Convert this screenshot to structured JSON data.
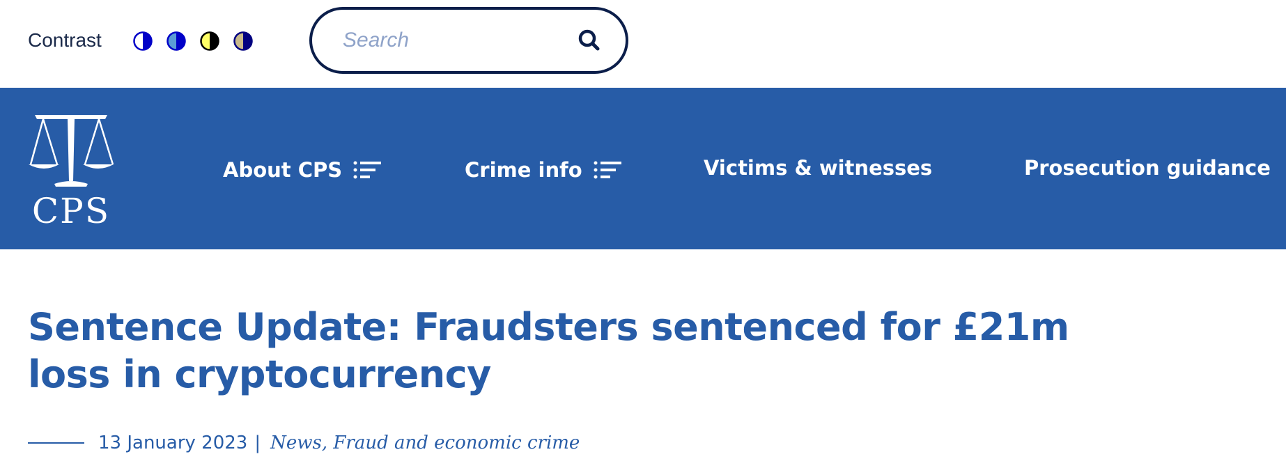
{
  "utility_bar": {
    "contrast_label": "Contrast",
    "contrast_options": [
      {
        "icon": "contrast-default-icon",
        "left_color": "#ffffff",
        "right_color": "#0000c8"
      },
      {
        "icon": "contrast-blue-icon",
        "left_color": "#5b9bd5",
        "right_color": "#0000c8"
      },
      {
        "icon": "contrast-yellow-icon",
        "left_color": "#ffff66",
        "right_color": "#000000"
      },
      {
        "icon": "contrast-beige-icon",
        "left_color": "#c8b98a",
        "right_color": "#000080"
      }
    ],
    "search": {
      "placeholder": "Search",
      "value": "",
      "icon": "search-icon"
    }
  },
  "nav": {
    "logo_text": "CPS",
    "items": [
      {
        "label": "About CPS",
        "has_menu_icon": true
      },
      {
        "label": "Crime info",
        "has_menu_icon": true
      },
      {
        "label": "Victims & witnesses",
        "has_menu_icon": false
      },
      {
        "label": "Prosecution guidance",
        "has_menu_icon": false
      }
    ]
  },
  "article": {
    "title": "Sentence Update: Fraudsters sentenced for £21m loss in cryptocurrency",
    "date": "13 January 2023",
    "separator": "|",
    "categories": "News, Fraud and economic crime"
  },
  "colors": {
    "brand_blue": "#275ca7",
    "dark_navy": "#0b1e4a",
    "white": "#ffffff"
  }
}
